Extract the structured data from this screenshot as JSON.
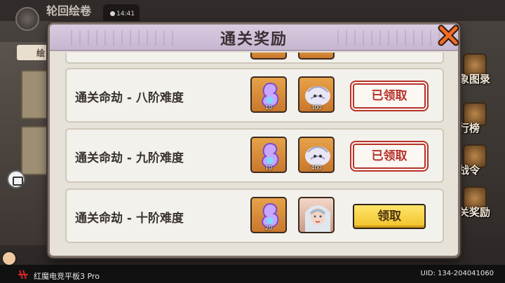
{
  "background": {
    "title": "轮回绘卷",
    "tab_label": "绘",
    "clock": "14:41",
    "right_menu": [
      "象图录",
      "行榜",
      "战令",
      "关奖励"
    ]
  },
  "modal": {
    "title": "通关奖励",
    "rows": [
      {
        "label": "通关命劫 - 八阶难度",
        "items": [
          {
            "icon": "crystal-icon",
            "count": "10"
          },
          {
            "icon": "dragon-icon",
            "count": "300"
          }
        ],
        "button": "已领取",
        "claimed": true
      },
      {
        "label": "通关命劫 - 九阶难度",
        "items": [
          {
            "icon": "crystal-icon",
            "count": "10"
          },
          {
            "icon": "dragon-icon",
            "count": "400"
          }
        ],
        "button": "已领取",
        "claimed": true
      },
      {
        "label": "通关命劫 - 十阶难度",
        "items": [
          {
            "icon": "crystal-icon",
            "count": "20"
          },
          {
            "icon": "portrait-icon",
            "count": ""
          }
        ],
        "button": "领取",
        "claimed": false
      }
    ]
  },
  "bottom_bar": {
    "device": "红魔电竞平板3 Pro",
    "uid": "UID: 134-204041060"
  },
  "colors": {
    "claimed_red": "#b8322a",
    "claim_yellow": "#f0c22a",
    "header_purple": "#c7b6d0"
  }
}
